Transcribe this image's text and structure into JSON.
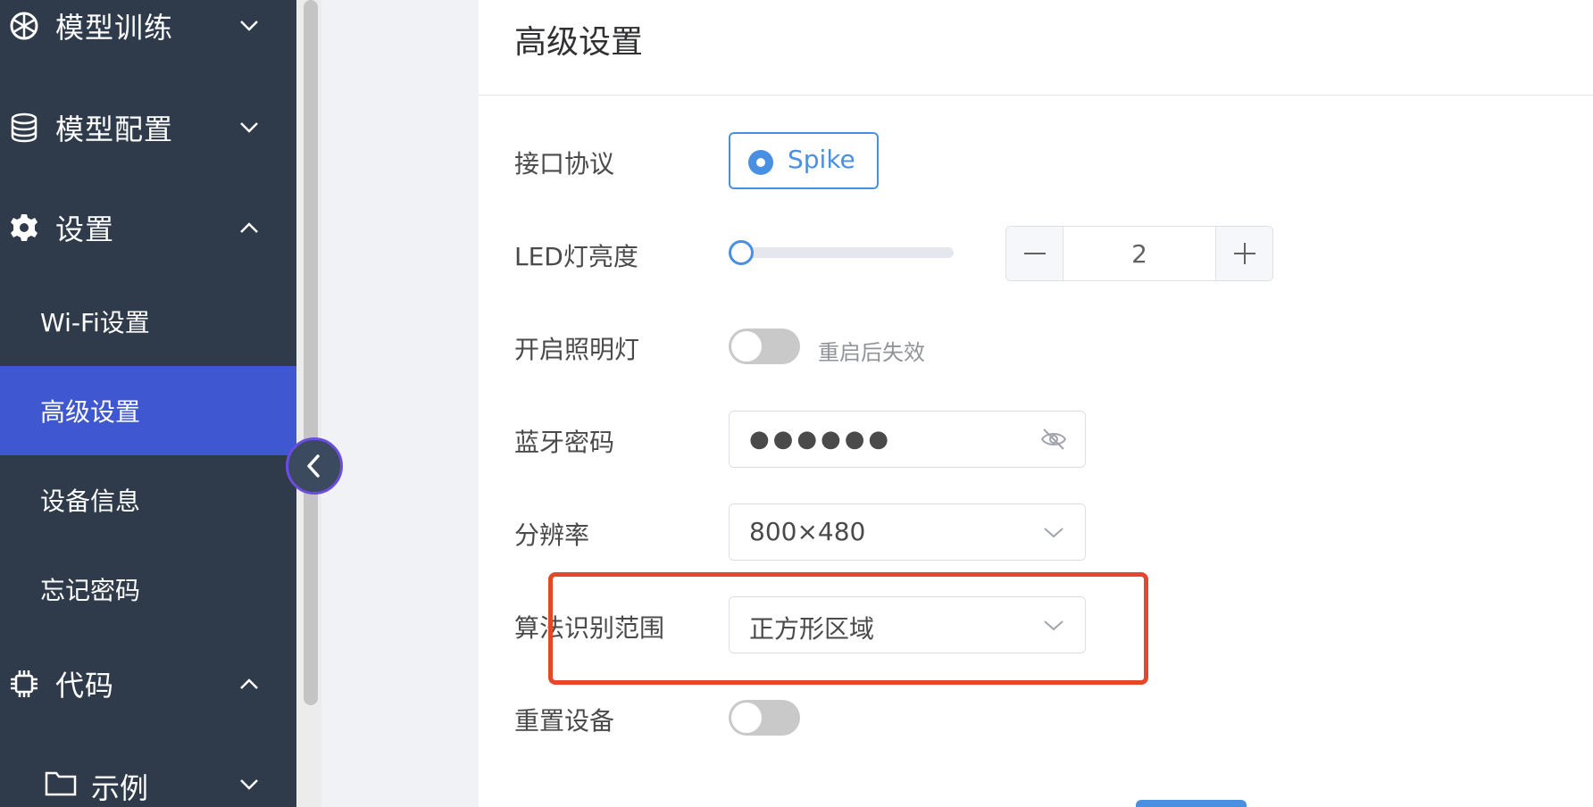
{
  "sidebar": {
    "model_training": {
      "label": "模型训练",
      "icon": "aperture-icon"
    },
    "model_config": {
      "label": "模型配置",
      "icon": "database-icon"
    },
    "settings": {
      "label": "设置",
      "icon": "gear-icon",
      "children": [
        "Wi-Fi设置",
        "高级设置",
        "设备信息",
        "忘记密码"
      ],
      "active": "高级设置"
    },
    "code": {
      "label": "代码",
      "icon": "chip-icon"
    },
    "examples": {
      "label": "示例",
      "icon": "folder-icon"
    }
  },
  "page": {
    "title": "高级设置"
  },
  "form": {
    "protocol": {
      "label": "接口协议",
      "option": "Spike"
    },
    "led": {
      "label": "LED灯亮度",
      "value": "2",
      "slider_fraction": 0
    },
    "light": {
      "label": "开启照明灯",
      "hint": "重启后失效",
      "enabled": false
    },
    "bt_password": {
      "label": "蓝牙密码",
      "value": "●●●●●●"
    },
    "resolution": {
      "label": "分辨率",
      "value": "800×480"
    },
    "algo_range": {
      "label": "算法识别范围",
      "value": "正方形区域"
    },
    "reset": {
      "label": "重置设备",
      "enabled": false
    }
  },
  "colors": {
    "sidebar_bg": "#2f3b4b",
    "active_item": "#3f57d1",
    "accent": "#4a90e2",
    "highlight": "#e5462c"
  }
}
